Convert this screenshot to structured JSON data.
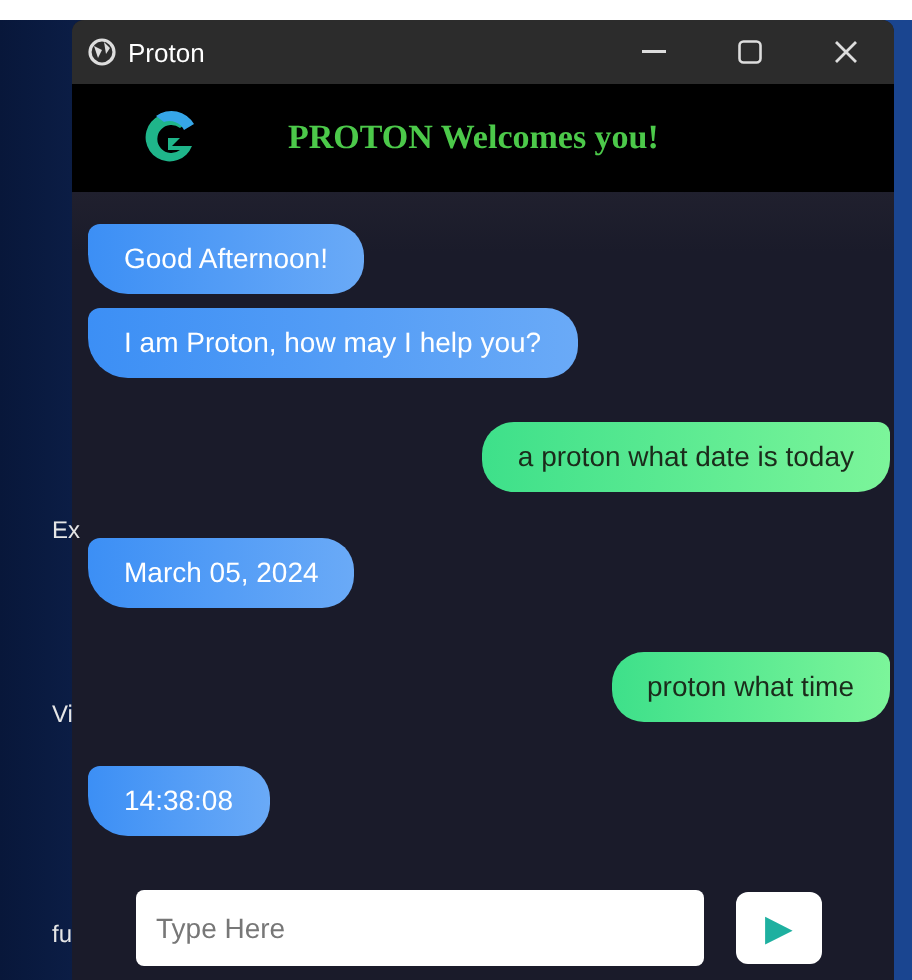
{
  "desktop": {
    "labels": [
      "Ex",
      "Vi",
      "fu"
    ]
  },
  "window": {
    "title": "Proton"
  },
  "header": {
    "title": "PROTON Welcomes you!"
  },
  "messages": [
    {
      "kind": "incoming",
      "text": "Good Afternoon!"
    },
    {
      "kind": "incoming",
      "text": "I am Proton, how may I help you?"
    },
    {
      "kind": "outgoing",
      "text": "a proton what date is today"
    },
    {
      "kind": "incoming",
      "text": "March 05, 2024"
    },
    {
      "kind": "outgoing",
      "text": "proton what time"
    },
    {
      "kind": "incoming",
      "text": "14:38:08"
    }
  ],
  "input": {
    "placeholder": "Type Here"
  },
  "send_button": {
    "icon": "▶"
  }
}
